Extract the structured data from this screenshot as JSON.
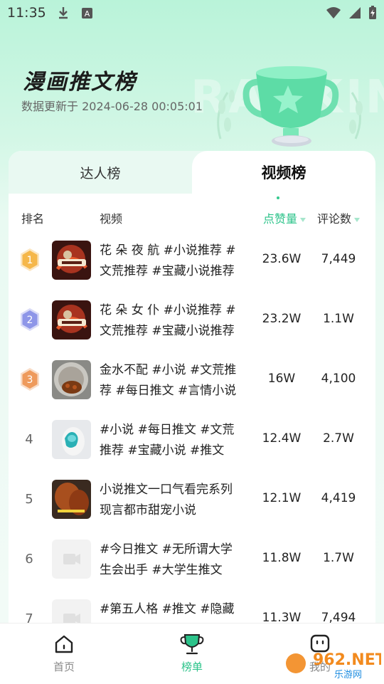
{
  "status": {
    "time": "11:35"
  },
  "hero": {
    "title": "漫画推文榜",
    "updated": "数据更新于 2024-06-28 00:05:01",
    "bg_word": "RANKING"
  },
  "tabs": [
    {
      "label": "达人榜",
      "active": false
    },
    {
      "label": "视频榜",
      "active": true
    }
  ],
  "table_header": {
    "rank": "排名",
    "video": "视频",
    "likes": "点赞量",
    "comments": "评论数"
  },
  "rows": [
    {
      "rank": "1",
      "medal": "gold",
      "title": "花 朵 夜 航 #小说推荐 #文荒推荐 #宝藏小说推荐",
      "likes": "23.6W",
      "comments": "7,449",
      "thumb": "comic-red"
    },
    {
      "rank": "2",
      "medal": "silver",
      "title": "花 朵 女 仆 #小说推荐 #文荒推荐 #宝藏小说推荐",
      "likes": "23.2W",
      "comments": "1.1W",
      "thumb": "comic-red"
    },
    {
      "rank": "3",
      "medal": "bronze",
      "title": "金水不配 #小说 #文荒推荐 #每日推文 #言情小说",
      "likes": "16W",
      "comments": "4,100",
      "thumb": "bowl"
    },
    {
      "rank": "4",
      "medal": "",
      "title": "#小说 #每日推文 #文荒推荐 #宝藏小说 #推文",
      "likes": "12.4W",
      "comments": "2.7W",
      "thumb": "hand"
    },
    {
      "rank": "5",
      "medal": "",
      "title": "小说推文一口气看完系列现言都市甜宠小说",
      "likes": "12.1W",
      "comments": "4,419",
      "thumb": "potato"
    },
    {
      "rank": "6",
      "medal": "",
      "title": "#今日推文 #无所谓大学生会出手 #大学生推文",
      "likes": "11.8W",
      "comments": "1.7W",
      "thumb": "placeholder"
    },
    {
      "rank": "7",
      "medal": "",
      "title": "#第五人格 #推文  #隐藏人格推荐",
      "likes": "11.3W",
      "comments": "7,494",
      "thumb": "placeholder"
    }
  ],
  "nav": [
    {
      "label": "首页",
      "icon": "home-icon",
      "active": false
    },
    {
      "label": "榜单",
      "icon": "trophy-icon",
      "active": true
    },
    {
      "label": "我的",
      "icon": "profile-icon",
      "active": false
    }
  ],
  "watermark": {
    "text": "962.NET",
    "sub": "乐游网"
  },
  "colors": {
    "accent": "#2cc38a",
    "gold": "#f5b74a",
    "silver": "#8e96e8",
    "bronze": "#ee9a5c"
  }
}
